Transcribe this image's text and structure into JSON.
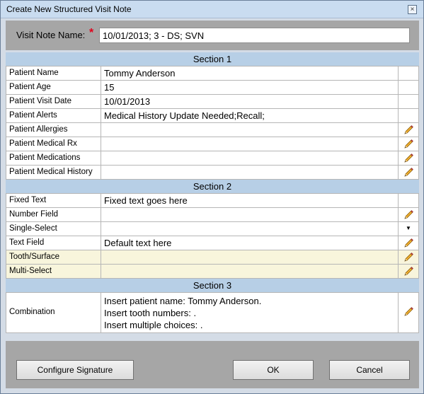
{
  "window": {
    "title": "Create New Structured Visit Note",
    "close_glyph": "×"
  },
  "visit_note": {
    "label": "Visit Note Name:",
    "required_mark": "*",
    "value": "10/01/2013; 3 - DS; SVN"
  },
  "sections": [
    {
      "title": "Section 1",
      "rows": [
        {
          "label": "Patient Name",
          "value": "Tommy Anderson",
          "action": "none"
        },
        {
          "label": "Patient Age",
          "value": "15",
          "action": "none"
        },
        {
          "label": "Patient Visit Date",
          "value": "10/01/2013",
          "action": "none"
        },
        {
          "label": "Patient Alerts",
          "value": "Medical History Update Needed;Recall;",
          "action": "none"
        },
        {
          "label": "Patient Allergies",
          "value": "",
          "action": "edit"
        },
        {
          "label": "Patient Medical Rx",
          "value": "",
          "action": "edit"
        },
        {
          "label": "Patient Medications",
          "value": "",
          "action": "edit"
        },
        {
          "label": "Patient Medical History",
          "value": "",
          "action": "edit"
        }
      ]
    },
    {
      "title": "Section 2",
      "rows": [
        {
          "label": "Fixed Text",
          "value": "Fixed text goes here",
          "action": "none"
        },
        {
          "label": "Number Field",
          "value": "",
          "action": "edit"
        },
        {
          "label": "Single-Select",
          "value": "",
          "action": "dropdown"
        },
        {
          "label": "Text Field",
          "value": "Default text here",
          "action": "edit"
        },
        {
          "label": "Tooth/Surface",
          "value": "",
          "action": "edit",
          "highlight": true
        },
        {
          "label": "Multi-Select",
          "value": "",
          "action": "edit",
          "highlight": true
        }
      ]
    },
    {
      "title": "Section 3",
      "rows": [
        {
          "label": "Combination",
          "value_lines": [
            "Insert patient name: Tommy Anderson.",
            "Insert tooth numbers: .",
            "Insert multiple choices: ."
          ],
          "action": "edit",
          "tall": true
        }
      ]
    }
  ],
  "buttons": {
    "configure_signature": "Configure Signature",
    "ok": "OK",
    "cancel": "Cancel"
  },
  "icons": {
    "edit": "pencil-icon",
    "dropdown": "dropdown-arrow-icon",
    "close": "close-icon"
  },
  "colors": {
    "section_header": "#b7cfe6",
    "highlight_row": "#f8f5dc",
    "panel_gray": "#a6a6a6",
    "required": "#e0001b"
  }
}
